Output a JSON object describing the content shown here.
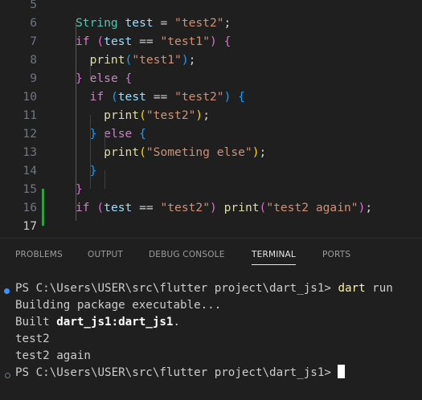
{
  "editor": {
    "lines": [
      {
        "num": "5",
        "parts": []
      },
      {
        "num": "6",
        "parts": [
          {
            "t": "String",
            "c": "k-type"
          },
          {
            "t": " "
          },
          {
            "t": "test",
            "c": "k-var"
          },
          {
            "t": " = ",
            "c": "k-op"
          },
          {
            "t": "\"test2\"",
            "c": "k-str"
          },
          {
            "t": ";",
            "c": "k-op"
          }
        ]
      },
      {
        "num": "7",
        "parts": [
          {
            "t": "if",
            "c": "k-kw"
          },
          {
            "t": " "
          },
          {
            "t": "(",
            "c": "b2"
          },
          {
            "t": "test",
            "c": "k-var"
          },
          {
            "t": " == ",
            "c": "k-op"
          },
          {
            "t": "\"test1\"",
            "c": "k-str"
          },
          {
            "t": ")",
            "c": "b2"
          },
          {
            "t": " "
          },
          {
            "t": "{",
            "c": "b2"
          }
        ]
      },
      {
        "num": "8",
        "parts": [
          {
            "t": "  "
          },
          {
            "t": "print",
            "c": "k-fn"
          },
          {
            "t": "(",
            "c": "b3"
          },
          {
            "t": "\"test1\"",
            "c": "k-str"
          },
          {
            "t": ")",
            "c": "b3"
          },
          {
            "t": ";",
            "c": "k-op"
          }
        ]
      },
      {
        "num": "9",
        "parts": [
          {
            "t": "}",
            "c": "b2"
          },
          {
            "t": " "
          },
          {
            "t": "else",
            "c": "k-kw"
          },
          {
            "t": " "
          },
          {
            "t": "{",
            "c": "b2"
          }
        ]
      },
      {
        "num": "10",
        "parts": [
          {
            "t": "  "
          },
          {
            "t": "if",
            "c": "k-kw"
          },
          {
            "t": " "
          },
          {
            "t": "(",
            "c": "b3"
          },
          {
            "t": "test",
            "c": "k-var"
          },
          {
            "t": " == ",
            "c": "k-op"
          },
          {
            "t": "\"test2\"",
            "c": "k-str"
          },
          {
            "t": ")",
            "c": "b3"
          },
          {
            "t": " "
          },
          {
            "t": "{",
            "c": "b3"
          }
        ]
      },
      {
        "num": "11",
        "parts": [
          {
            "t": "    "
          },
          {
            "t": "print",
            "c": "k-fn"
          },
          {
            "t": "(",
            "c": "b1"
          },
          {
            "t": "\"test2\"",
            "c": "k-str"
          },
          {
            "t": ")",
            "c": "b1"
          },
          {
            "t": ";",
            "c": "k-op"
          }
        ]
      },
      {
        "num": "12",
        "parts": [
          {
            "t": "  "
          },
          {
            "t": "}",
            "c": "b3"
          },
          {
            "t": " "
          },
          {
            "t": "else",
            "c": "k-kw"
          },
          {
            "t": " "
          },
          {
            "t": "{",
            "c": "b3"
          }
        ]
      },
      {
        "num": "13",
        "parts": [
          {
            "t": "    "
          },
          {
            "t": "print",
            "c": "k-fn"
          },
          {
            "t": "(",
            "c": "b1"
          },
          {
            "t": "\"Someting else\"",
            "c": "k-str"
          },
          {
            "t": ")",
            "c": "b1"
          },
          {
            "t": ";",
            "c": "k-op"
          }
        ]
      },
      {
        "num": "14",
        "parts": [
          {
            "t": "  "
          },
          {
            "t": "}",
            "c": "b3"
          }
        ]
      },
      {
        "num": "15",
        "parts": [
          {
            "t": "}",
            "c": "b2"
          }
        ]
      },
      {
        "num": "16",
        "parts": [
          {
            "t": "if",
            "c": "k-kw"
          },
          {
            "t": " "
          },
          {
            "t": "(",
            "c": "b2"
          },
          {
            "t": "test",
            "c": "k-var"
          },
          {
            "t": " == ",
            "c": "k-op"
          },
          {
            "t": "\"test2\"",
            "c": "k-str"
          },
          {
            "t": ")",
            "c": "b2"
          },
          {
            "t": " "
          },
          {
            "t": "print",
            "c": "k-fn"
          },
          {
            "t": "(",
            "c": "b2"
          },
          {
            "t": "\"test2 again\"",
            "c": "k-str"
          },
          {
            "t": ")",
            "c": "b2"
          },
          {
            "t": ";",
            "c": "k-op"
          }
        ]
      },
      {
        "num": "17",
        "parts": []
      }
    ]
  },
  "panel": {
    "tabs": [
      {
        "label": "PROBLEMS",
        "active": false
      },
      {
        "label": "OUTPUT",
        "active": false
      },
      {
        "label": "DEBUG CONSOLE",
        "active": false
      },
      {
        "label": "TERMINAL",
        "active": true
      },
      {
        "label": "PORTS",
        "active": false
      }
    ],
    "terminal": {
      "prompt1": "PS C:\\Users\\USER\\src\\flutter project\\dart_js1> ",
      "cmd_word": "dart",
      "cmd_arg": " run",
      "line2": "Building package executable...",
      "built_prefix": "Built ",
      "built_target": "dart_js1:dart_js1",
      "built_suffix": ".",
      "out1": "test2",
      "out2": "test2 again",
      "prompt2": "PS C:\\Users\\USER\\src\\flutter project\\dart_js1> ",
      "dot1_color": "#3794ff",
      "dot2_color": "#6e7681"
    }
  },
  "colors": {
    "added_bar": "#2ea043",
    "modified_bar": "#0078d4"
  }
}
